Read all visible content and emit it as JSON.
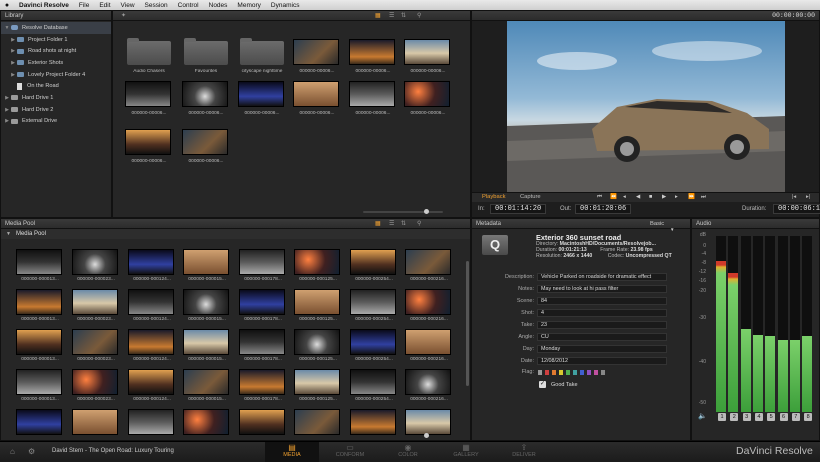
{
  "menubar": {
    "apple": "",
    "app_name": "Davinci Resolve",
    "items": [
      "File",
      "Edit",
      "View",
      "Session",
      "Control",
      "Nodes",
      "Memory",
      "Dynamics"
    ]
  },
  "library": {
    "title": "Library",
    "tree": [
      {
        "label": "Resolve Database",
        "kind": "db",
        "level": 0
      },
      {
        "label": "Project Folder 1",
        "kind": "folder",
        "level": 1
      },
      {
        "label": "Road shots at night",
        "kind": "folder",
        "level": 1
      },
      {
        "label": "Exterior Shots",
        "kind": "folder",
        "level": 1
      },
      {
        "label": "Lovely Project Folder 4",
        "kind": "folder",
        "level": 1
      },
      {
        "label": "On the Road",
        "kind": "doc",
        "level": 1
      },
      {
        "label": "Hard Drive 1",
        "kind": "drive",
        "level": 0
      },
      {
        "label": "Hard Drive 2",
        "kind": "drive",
        "level": 0
      },
      {
        "label": "External Drive",
        "kind": "drive",
        "level": 0
      }
    ],
    "folders": [
      "Audio Chasers",
      "Favourites",
      "cityscape nighttime"
    ],
    "clip_label": "000000-00006..."
  },
  "viewer": {
    "timecode_top": "00:00:00:00",
    "tabs": [
      "Playback",
      "Capture"
    ],
    "in_label": "In:",
    "in_value": "00:01:14:20",
    "out_label": "Out:",
    "out_value": "00:01:20:06",
    "duration_label": "Duration:",
    "duration_value": "00:00:06:12"
  },
  "media_pool": {
    "title": "Media Pool",
    "root": "Media Pool",
    "captions": [
      "000000-000013...",
      "000000-000023...",
      "000000-000124...",
      "000000-000015...",
      "000000-000178...",
      "000000-000125...",
      "000000-000254...",
      "000000-000216..."
    ]
  },
  "metadata": {
    "title": "Metadata",
    "preset": "Basic",
    "clip_name": "Exterior 360 sunset road",
    "directory_label": "Directory:",
    "directory": "MacintoshHD/Documents/Resolvejob...",
    "duration_label": "Duration:",
    "duration": "00:01:21:13",
    "framerate_label": "Frame Rate:",
    "framerate": "23.98 fps",
    "resolution_label": "Resolution:",
    "resolution": "2466 x 1440",
    "codec_label": "Codec:",
    "codec": "Uncompressed QT",
    "fields": [
      {
        "label": "Description:",
        "value": "Vehicle Parked on roadside for dramatic effect"
      },
      {
        "label": "Notes:",
        "value": "May need to look at hi pass filter"
      },
      {
        "label": "Scene:",
        "value": "84"
      },
      {
        "label": "Shot:",
        "value": "4"
      },
      {
        "label": "Take:",
        "value": "23"
      },
      {
        "label": "Angle:",
        "value": "CU"
      },
      {
        "label": "Day:",
        "value": "Monday"
      },
      {
        "label": "Date:",
        "value": "12/08/2012"
      }
    ],
    "flag_label": "Flag:",
    "flag_colors": [
      "#9a9a9a",
      "#d04040",
      "#e07a30",
      "#d8c830",
      "#50b050",
      "#40a0a0",
      "#4060d0",
      "#9050c0",
      "#c050a0",
      "#888"
    ],
    "good_take": "Good Take"
  },
  "audio": {
    "title": "Audio",
    "scale": [
      "dB",
      "0",
      "-4",
      "-8",
      "-12",
      "-16",
      "-20",
      "-30",
      "-40",
      "-50"
    ],
    "levels": [
      0.86,
      0.79,
      0.47,
      0.44,
      0.43,
      0.41,
      0.41,
      0.43
    ],
    "channels": [
      "1",
      "2",
      "3",
      "4",
      "5",
      "6",
      "7",
      "8"
    ]
  },
  "bottom": {
    "project": "David Stern - The Open Road: Luxury Touring",
    "tabs": [
      "MEDIA",
      "CONFORM",
      "COLOR",
      "GALLERY",
      "DELIVER"
    ],
    "brand": "DaVinci Resolve"
  },
  "colors": {
    "accent": "#f0a030",
    "panel": "#262626",
    "meter": "#52b84a"
  }
}
